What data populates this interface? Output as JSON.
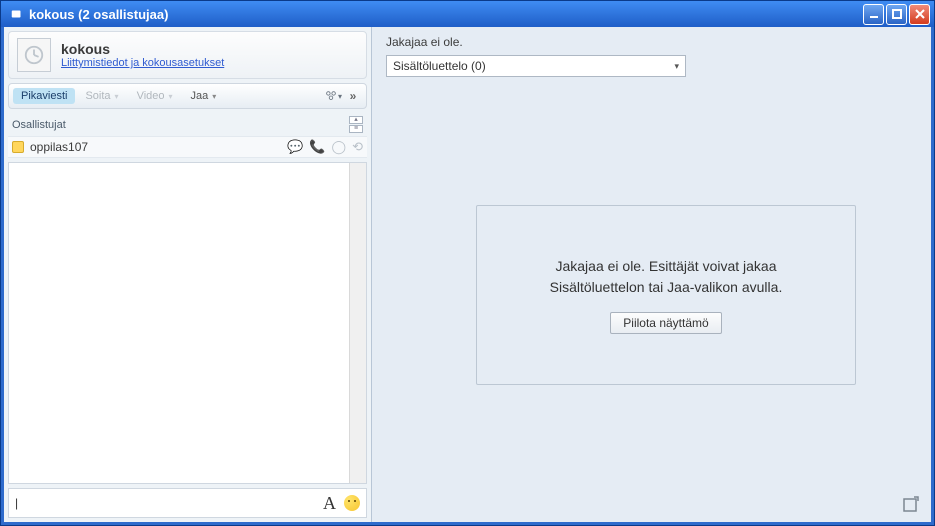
{
  "titlebar": {
    "title": "kokous (2 osallistujaa)"
  },
  "header": {
    "name": "kokous",
    "settings_link": "Liittymistiedot ja kokousasetukset"
  },
  "toolbar": {
    "im_tab": "Pikaviesti",
    "call_tab": "Soita",
    "video_tab": "Video",
    "share_tab": "Jaa",
    "gear_icon": "gear-icon",
    "overflow_icon": "»"
  },
  "participants": {
    "header": "Osallistujat",
    "items": [
      {
        "name": "oppilas107"
      }
    ]
  },
  "input": {
    "value": "",
    "placeholder": ""
  },
  "share": {
    "status": "Jakajaa ei ole.",
    "content_list_label": "Sisältöluettelo (0)"
  },
  "placeholder": {
    "line1": "Jakajaa ei ole. Esittäjät voivat jakaa",
    "line2": "Sisältöluettelon tai Jaa-valikon avulla.",
    "hide_button": "Piilota näyttämö"
  }
}
